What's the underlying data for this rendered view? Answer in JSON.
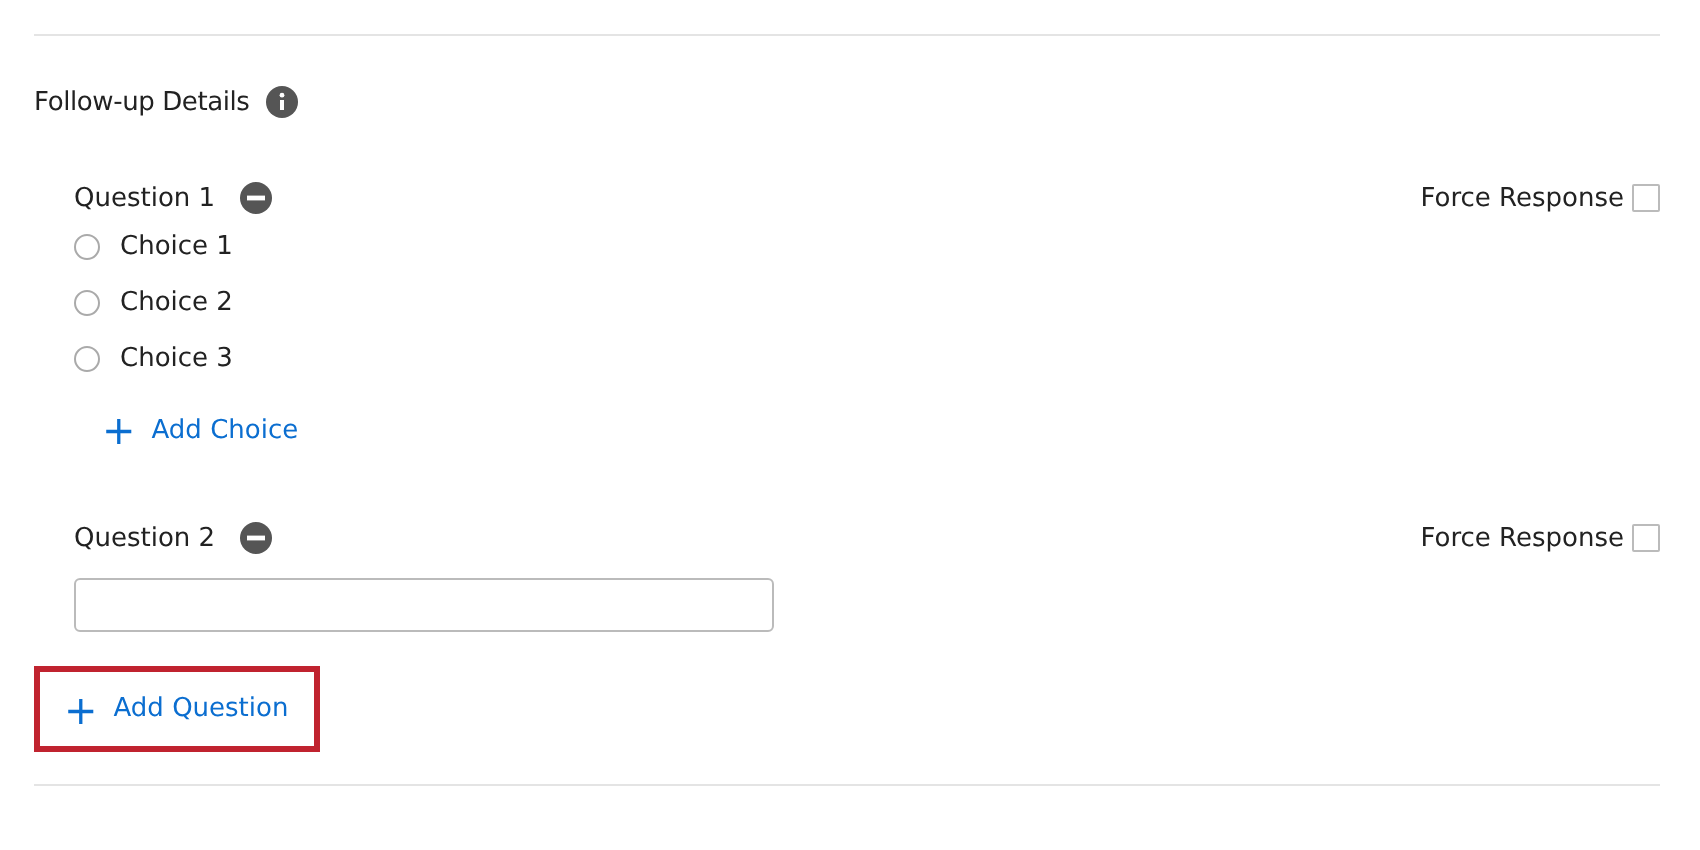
{
  "section": {
    "title": "Follow-up Details"
  },
  "questions": [
    {
      "kind": "choice",
      "label": "Question 1",
      "force_response": {
        "label": "Force Response",
        "checked": false
      },
      "choices": [
        {
          "label": "Choice 1",
          "selected": false
        },
        {
          "label": "Choice 2",
          "selected": false
        },
        {
          "label": "Choice 3",
          "selected": false
        }
      ],
      "add_choice": {
        "icon": "+",
        "label": "Add Choice"
      }
    },
    {
      "kind": "text",
      "label": "Question 2",
      "force_response": {
        "label": "Force Response",
        "checked": false
      }
    }
  ],
  "add_question": {
    "icon": "+",
    "label": "Add Question",
    "highlighted": true
  }
}
